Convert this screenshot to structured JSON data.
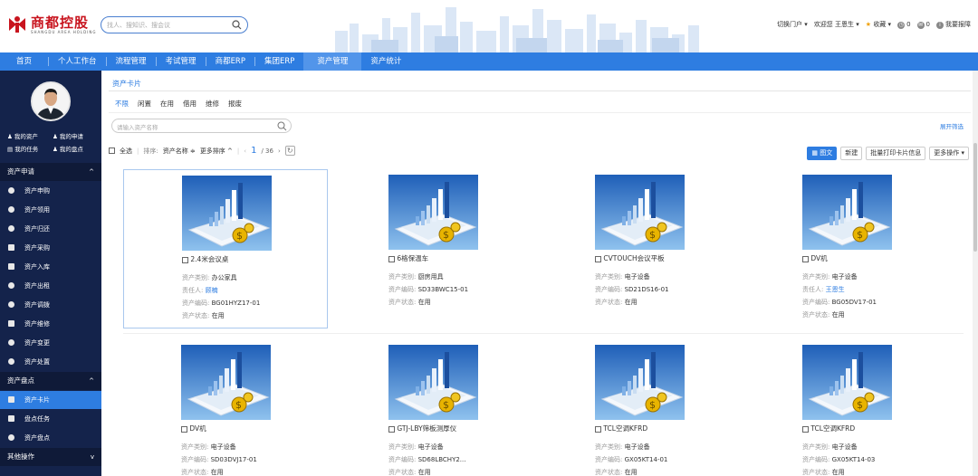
{
  "header": {
    "logo_cn": "商都控股",
    "logo_en": "SHANGDU AREA HOLDING",
    "search_placeholder": "找人、搜知识、搜会议",
    "links": [
      {
        "label": "切换门户",
        "icon": "chevron-down-icon"
      },
      {
        "label": "欢迎您  王恩生",
        "icon": "chevron-down-icon"
      },
      {
        "label": "收藏",
        "icon": "star-icon"
      },
      {
        "label": "0",
        "icon": "clock-icon"
      },
      {
        "label": "0",
        "icon": "message-icon"
      },
      {
        "label": "我要报障",
        "icon": "info-icon"
      }
    ]
  },
  "nav": {
    "items": [
      "首页",
      "个人工作台",
      "流程管理",
      "考试管理",
      "商都ERP",
      "集团ERP",
      "资产管理",
      "资产统计"
    ],
    "active_index": 6
  },
  "sidebar": {
    "quick": [
      "我的资产",
      "我的申请",
      "我的任务",
      "我的盘点"
    ],
    "groups": [
      {
        "label": "资产申请",
        "items": [
          "资产申购",
          "资产领用",
          "资产归还",
          "资产采购",
          "资产入库",
          "资产出租",
          "资产调拨",
          "资产维修",
          "资产变更",
          "资产处置"
        ]
      },
      {
        "label": "资产盘点",
        "items": [
          "资产卡片",
          "盘点任务",
          "资产盘点"
        ]
      },
      {
        "label": "其他操作",
        "items": []
      }
    ],
    "active_item": "资产卡片"
  },
  "main": {
    "breadcrumb": "资产卡片",
    "filters": [
      "不限",
      "闲置",
      "在用",
      "借用",
      "维修",
      "报废"
    ],
    "active_filter": 0,
    "search_placeholder": "请输入资产名称",
    "expand_label": "展开筛选",
    "toolbar": {
      "select_all": "全选",
      "sort_label": "排序:",
      "sort_field": "资产名称 ≑",
      "more_sort": "更多排序 ^",
      "page_current": "1",
      "page_total": "/ 36"
    },
    "buttons": {
      "graphic": "图文",
      "new": "新建",
      "print": "批量打印卡片信息",
      "more": "更多操作"
    }
  },
  "cards": [
    {
      "title": "2.4米会议桌",
      "rows": [
        {
          "k": "资产类别:",
          "v": "办公家具"
        },
        {
          "k": "责任人:",
          "v": "顾楠",
          "link": true
        },
        {
          "k": "资产编码:",
          "v": "BG01HYZ17-01"
        },
        {
          "k": "资产状态:",
          "v": "在用"
        }
      ]
    },
    {
      "title": "6格保温车",
      "rows": [
        {
          "k": "资产类别:",
          "v": "厨房用具"
        },
        {
          "k": "资产编码:",
          "v": "SD33BWC15-01"
        },
        {
          "k": "资产状态:",
          "v": "在用"
        }
      ]
    },
    {
      "title": "CVTOUCH会议平板",
      "rows": [
        {
          "k": "资产类别:",
          "v": "电子设备"
        },
        {
          "k": "资产编码:",
          "v": "SD21DS16-01"
        },
        {
          "k": "资产状态:",
          "v": "在用"
        }
      ]
    },
    {
      "title": "DV机",
      "rows": [
        {
          "k": "资产类别:",
          "v": "电子设备"
        },
        {
          "k": "责任人:",
          "v": "王恩生",
          "link": true
        },
        {
          "k": "资产编码:",
          "v": "BG05DV17-01"
        },
        {
          "k": "资产状态:",
          "v": "在用"
        }
      ]
    },
    {
      "title": "DV机",
      "rows": [
        {
          "k": "资产类别:",
          "v": "电子设备"
        },
        {
          "k": "资产编码:",
          "v": "SD03DVJ17-01"
        },
        {
          "k": "资产状态:",
          "v": "在用"
        }
      ]
    },
    {
      "title": "GTJ-LBY筛板测厚仪",
      "rows": [
        {
          "k": "资产类别:",
          "v": "电子设备"
        },
        {
          "k": "资产编码:",
          "v": "SD68LBCHY2..."
        },
        {
          "k": "资产状态:",
          "v": "在用"
        }
      ]
    },
    {
      "title": "TCL空调KFRD",
      "rows": [
        {
          "k": "资产类别:",
          "v": "电子设备"
        },
        {
          "k": "资产编码:",
          "v": "GX05KT14-01"
        },
        {
          "k": "资产状态:",
          "v": "在用"
        }
      ]
    },
    {
      "title": "TCL空调KFRD",
      "rows": [
        {
          "k": "资产类别:",
          "v": "电子设备"
        },
        {
          "k": "资产编码:",
          "v": "GX05KT14-03"
        },
        {
          "k": "资产状态:",
          "v": "在用"
        }
      ]
    }
  ],
  "colors": {
    "accent": "#2e7de1",
    "sidebar": "#14234b",
    "logo": "#c8141e"
  }
}
